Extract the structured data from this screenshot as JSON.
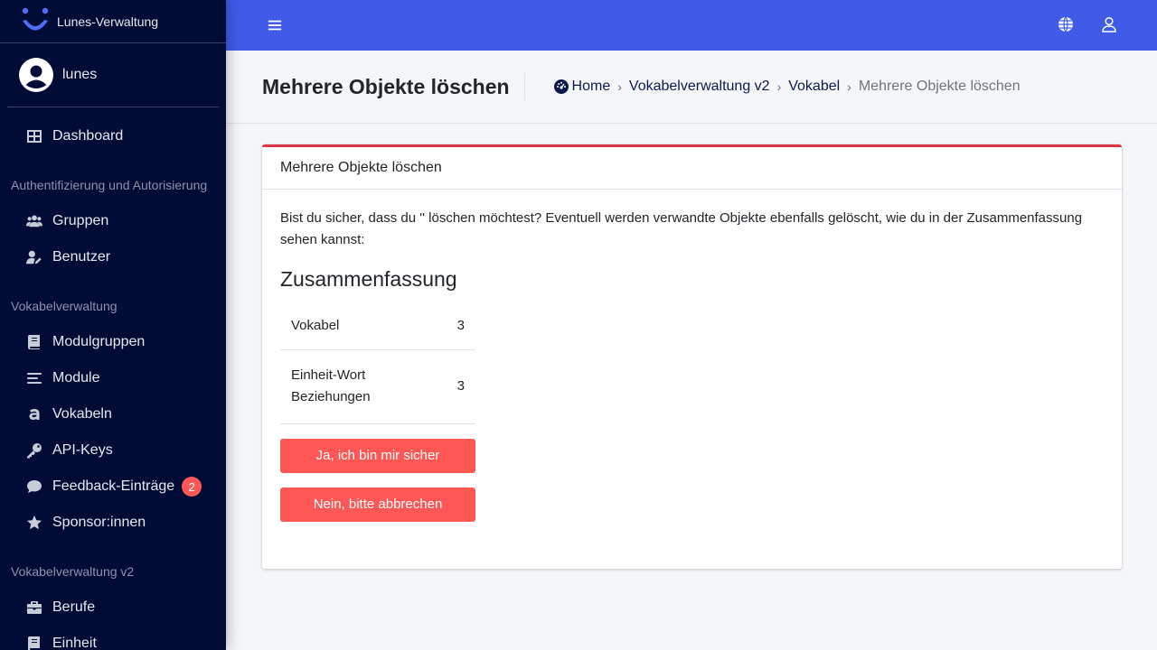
{
  "brand": {
    "name": "Lunes-Verwaltung"
  },
  "user": {
    "name": "lunes"
  },
  "sidebar": {
    "dashboard": "Dashboard",
    "section_auth": "Authentifizierung und Autorisierung",
    "groups": "Gruppen",
    "users": "Benutzer",
    "section_vocab": "Vokabelverwaltung",
    "module_groups": "Modulgruppen",
    "modules": "Module",
    "vocabulary": "Vokabeln",
    "api_keys": "API-Keys",
    "feedback": "Feedback-Einträge",
    "feedback_badge": "2",
    "sponsors": "Sponsor:innen",
    "section_vocab_v2": "Vokabelverwaltung v2",
    "professions": "Berufe",
    "unit": "Einheit"
  },
  "header": {
    "title": "Mehrere Objekte löschen",
    "breadcrumb": {
      "home": "Home",
      "app": "Vokabelverwaltung v2",
      "model": "Vokabel",
      "current": "Mehrere Objekte löschen"
    }
  },
  "card": {
    "title": "Mehrere Objekte löschen",
    "confirm_text": "Bist du sicher, dass du '' löschen möchtest? Eventuell werden verwandte Objekte ebenfalls gelöscht, wie du in der Zusammenfassung sehen kannst:",
    "summary_title": "Zusammenfassung",
    "summary": [
      {
        "label": "Vokabel",
        "count": "3"
      },
      {
        "label": "Einheit-Wort Beziehungen",
        "count": "3"
      }
    ],
    "confirm_button": "Ja, ich bin mir sicher",
    "cancel_button": "Nein, bitte abbrechen"
  },
  "colors": {
    "sidebar_bg": "#000b36",
    "topbar_bg": "#3f5be8",
    "danger": "#ff5656",
    "card_border": "#dc3545"
  }
}
